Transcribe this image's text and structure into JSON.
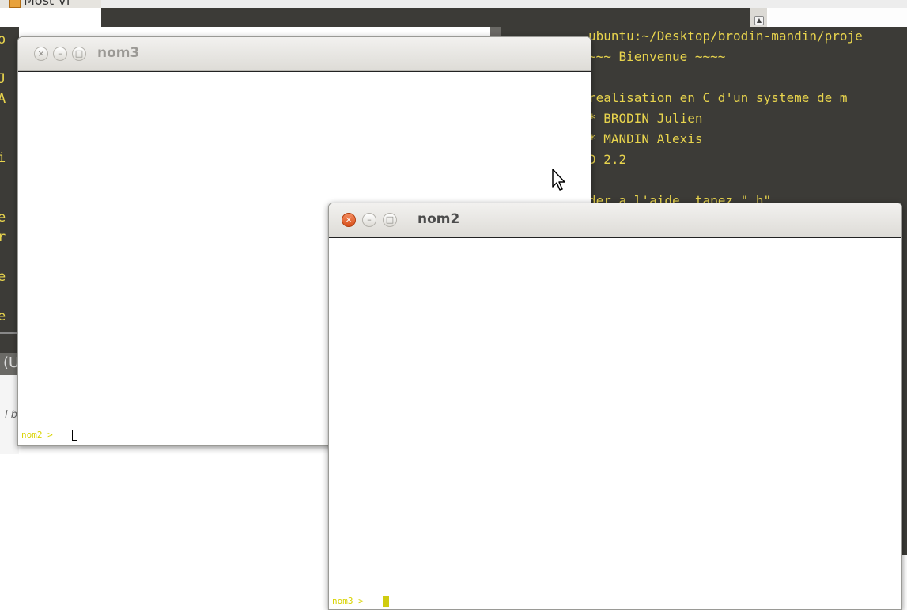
{
  "top_tab": {
    "title": "Most Vi"
  },
  "bg_terminal_right": {
    "lines": [
      "ubuntu:~/Desktop/brodin-mandin/proje",
      "~~~ Bienvenue ~~~~",
      "",
      "realisation en C d'un systeme de m",
      "* BRODIN Julien",
      "* MANDIN Alexis",
      "D 2.2",
      "",
      "der a l'aide, tapez \" h\""
    ]
  },
  "bg_terminal_left": {
    "lines": [
      "o",
      "",
      "J",
      "A",
      "",
      "",
      "i",
      "",
      "",
      "e",
      "r",
      "",
      "e",
      "",
      "e"
    ]
  },
  "bg_left_misc": {
    "text1": "(U",
    "text2": "l b"
  },
  "window_nom3": {
    "title": "nom3",
    "prompt": "nom2 > ",
    "buttons": {
      "close": "×",
      "minimize": "–",
      "maximize": "□"
    }
  },
  "window_nom2": {
    "title": "nom2",
    "prompt": "nom3 > ",
    "buttons": {
      "close": "×",
      "minimize": "–",
      "maximize": "□"
    }
  },
  "colors": {
    "terminal_bg": "#3c3b37",
    "terminal_text": "#e8d44d",
    "prompt_text": "#d8d300",
    "close_active": "#e05a22"
  }
}
